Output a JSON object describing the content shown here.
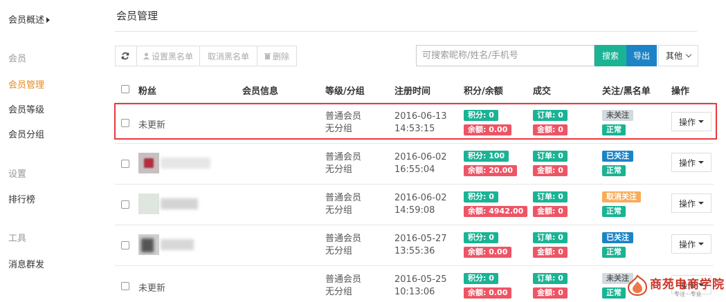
{
  "sidebar": {
    "top_item": "会员概述",
    "sections": [
      {
        "title": "会员",
        "items": [
          "会员管理",
          "会员等级",
          "会员分组"
        ]
      },
      {
        "title": "设置",
        "items": [
          "排行榜"
        ]
      },
      {
        "title": "工具",
        "items": [
          "消息群发"
        ]
      }
    ],
    "active_item": "会员管理"
  },
  "page": {
    "title": "会员管理"
  },
  "toolbar": {
    "refresh_icon": "refresh-icon",
    "set_blacklist": "设置黑名单",
    "cancel_blacklist": "取消黑名单",
    "delete": "删除"
  },
  "search": {
    "placeholder": "可搜索昵称/姓名/手机号",
    "search_label": "搜索",
    "export_label": "导出",
    "other_label": "其他"
  },
  "table": {
    "headers": [
      "粉丝",
      "会员信息",
      "等级/分组",
      "注册时间",
      "积分/余额",
      "成交",
      "关注/黑名单",
      "操作"
    ],
    "rows": [
      {
        "fan": "未更新",
        "level": "普通会员",
        "group": "无分组",
        "date": "2016-06-13",
        "time": "14:53:15",
        "points": "积分: 0",
        "balance": "余额: 0.00",
        "orders": "订单: 0",
        "amount": "金额: 0",
        "follow": "未关注",
        "follow_style": "gray",
        "status": "正常",
        "op": "操作"
      },
      {
        "fan": "",
        "level": "普通会员",
        "group": "无分组",
        "date": "2016-06-02",
        "time": "16:55:04",
        "points": "积分: 100",
        "balance": "余额: 20.00",
        "orders": "订单: 0",
        "amount": "金额: 0",
        "follow": "已关注",
        "follow_style": "blue",
        "status": "正常",
        "op": "操作"
      },
      {
        "fan": "",
        "level": "普通会员",
        "group": "无分组",
        "date": "2016-06-02",
        "time": "14:59:08",
        "points": "积分: 0",
        "balance": "余额: 4942.00",
        "orders": "订单: 0",
        "amount": "金额: 0",
        "follow": "取消关注",
        "follow_style": "orange",
        "status": "正常",
        "op": "操作"
      },
      {
        "fan": "",
        "level": "普通会员",
        "group": "无分组",
        "date": "2016-05-27",
        "time": "13:55:36",
        "points": "积分: 0",
        "balance": "余额: 0.00",
        "orders": "订单: 0",
        "amount": "金额: 0",
        "follow": "已关注",
        "follow_style": "blue",
        "status": "正常",
        "op": "操作"
      },
      {
        "fan": "未更新",
        "level": "普通会员",
        "group": "无分组",
        "date": "2016-05-25",
        "time": "10:13:06",
        "points": "积分: 0",
        "balance": "余额: 0.00",
        "orders": "订单: 0",
        "amount": "金额: 0",
        "follow": "未关注",
        "follow_style": "gray",
        "status": "正常",
        "op": "操作"
      }
    ]
  },
  "watermark": {
    "text": "商苑电商学院",
    "sub": "专注 · 专业"
  },
  "colors": {
    "accent_orange": "#e48a1e",
    "green": "#1ab394",
    "red": "#ed5565",
    "blue": "#1c84c6",
    "orange": "#f8ac59",
    "highlight": "#e8383d"
  }
}
